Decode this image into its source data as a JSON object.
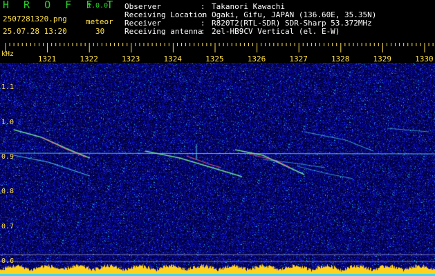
{
  "header": {
    "app_name": "H R O F F T",
    "app_version": "1.0.0",
    "filename": "2507281320.png",
    "datetime": "25.07.28 13:20",
    "detection_type": "meteor",
    "detection_count": "30",
    "meta": [
      {
        "key": "Observer",
        "value": "Takanori Kawachi"
      },
      {
        "key": "Receiving Location",
        "value": "Ogaki, Gifu, JAPAN (136.60E, 35.35N)"
      },
      {
        "key": "Receiver",
        "value": "R820T2(RTL-SDR) SDR-Sharp 53.372MHz"
      },
      {
        "key": "Receiving antenna",
        "value": "2el-HB9CV Vertical (el. E-W)"
      }
    ]
  },
  "axis": {
    "unit": "kHz",
    "time_ticks": [
      "1321",
      "1322",
      "1323",
      "1324",
      "1325",
      "1326",
      "1327",
      "1328",
      "1329",
      "1330"
    ],
    "freq_ticks": [
      "1.1",
      "1.0",
      "0.9",
      "0.8",
      "0.7",
      "0.6"
    ]
  },
  "colors": {
    "background": "#000000",
    "noise": "#10108a",
    "carrier": "#55e8ff",
    "trail": "#ff5a8c",
    "label": "#ffe14a",
    "title": "#2bd12b"
  }
}
